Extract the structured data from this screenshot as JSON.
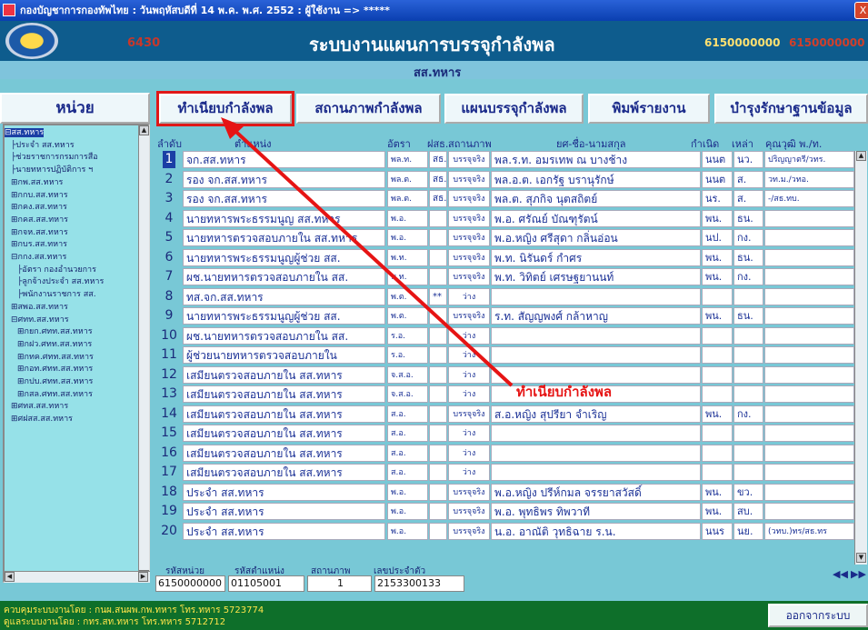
{
  "window": {
    "title": "กองบัญชาการกองทัพไทย : วันพฤหัสบดีที่ 14 พ.ค. พ.ศ. 2552 : ผู้ใช้งาน => *****",
    "close": "X"
  },
  "header": {
    "code": "6430",
    "title": "ระบบงานแผนการบรรจุกำลังพล",
    "num1": "6150000000",
    "num2": "6150000000",
    "subtitle": "สส.ทหาร"
  },
  "tabs": {
    "unit": "หน่วย",
    "t1": "ทำเนียบกำลังพล",
    "t2": "สถานภาพกำลังพล",
    "t3": "แผนบรรจุกำลังพล",
    "t4": "พิมพ์รายงาน",
    "t5": "บำรุงรักษาฐานข้อมูล"
  },
  "tree": [
    {
      "label": "สส.ทหาร",
      "prefix": "⊟",
      "indent": 0,
      "selected": true
    },
    {
      "label": "ประจำ สส.ทหาร",
      "prefix": "├",
      "indent": 1
    },
    {
      "label": "ช่วยราชการกรมการสื่อ",
      "prefix": "├",
      "indent": 1
    },
    {
      "label": "นายทหารปฏิบัติการ ฯ",
      "prefix": "├",
      "indent": 1
    },
    {
      "label": "กพ.สส.ทหาร",
      "prefix": "⊞",
      "indent": 1
    },
    {
      "label": "กกบ.สส.ทหาร",
      "prefix": "⊞",
      "indent": 1
    },
    {
      "label": "กคง.สส.ทหาร",
      "prefix": "⊞",
      "indent": 1
    },
    {
      "label": "กคส.สส.ทหาร",
      "prefix": "⊞",
      "indent": 1
    },
    {
      "label": "กจห.สส.ทหาร",
      "prefix": "⊞",
      "indent": 1
    },
    {
      "label": "กบร.สส.ทหาร",
      "prefix": "⊞",
      "indent": 1
    },
    {
      "label": "กกง.สส.ทหาร",
      "prefix": "⊟",
      "indent": 1
    },
    {
      "label": "อัตรา กองอำนวยการ",
      "prefix": "├",
      "indent": 2
    },
    {
      "label": "ลูกจ้างประจำ สส.ทหาร",
      "prefix": "├",
      "indent": 2
    },
    {
      "label": "พนักงานราชการ สส.",
      "prefix": "├",
      "indent": 2
    },
    {
      "label": "สพอ.สส.ทหาร",
      "prefix": "⊞",
      "indent": 1
    },
    {
      "label": "ศทท.สส.ทหาร",
      "prefix": "⊟",
      "indent": 1
    },
    {
      "label": "กยก.ศทท.สส.ทหาร",
      "prefix": "⊞",
      "indent": 2
    },
    {
      "label": "กฝว.ศทท.สส.ทหาร",
      "prefix": "⊞",
      "indent": 2
    },
    {
      "label": "กทค.ศทท.สส.ทหาร",
      "prefix": "⊞",
      "indent": 2
    },
    {
      "label": "กอท.ศทท.สส.ทหาร",
      "prefix": "⊞",
      "indent": 2
    },
    {
      "label": "กปบ.ศทท.สส.ทหาร",
      "prefix": "⊞",
      "indent": 2
    },
    {
      "label": "กสล.ศทท.สส.ทหาร",
      "prefix": "⊞",
      "indent": 2
    },
    {
      "label": "ศทส.สส.ทหาร",
      "prefix": "⊞",
      "indent": 1
    },
    {
      "label": "ศฝสส.สส.ทหาร",
      "prefix": "⊞",
      "indent": 1
    }
  ],
  "grid": {
    "headers": {
      "no": "ลำดับ",
      "position": "ตำแหน่ง",
      "rate": "อัตรา",
      "flag": "ฝสธ.",
      "status": "สถานภาพ",
      "name": "ยศ-ชื่อ-นามสกุล",
      "born": "กำเนิด",
      "cls": "เหล่า",
      "edu": "คุณวุฒิ พ./ท."
    },
    "rows": [
      {
        "no": "1",
        "position": "จก.สส.ทหาร",
        "rate": "พล.ท.",
        "flag": "สธ.",
        "status": "บรรจุจริง",
        "name": "พล.ร.ท. อมรเทพ ณ บางช้าง",
        "born": "นนต",
        "cls": "นว.",
        "edu": "ปริญญาตรี/วทร."
      },
      {
        "no": "2",
        "position": "รอง จก.สส.ทหาร",
        "rate": "พล.ต.",
        "flag": "สธ.",
        "status": "บรรจุจริง",
        "name": "พล.อ.ต. เอกรัฐ บรานุรักษ์",
        "born": "นนต",
        "cls": "ส.",
        "edu": "วท.ม./วทอ."
      },
      {
        "no": "3",
        "position": "รอง จก.สส.ทหาร",
        "rate": "พล.ต.",
        "flag": "สธ.",
        "status": "บรรจุจริง",
        "name": "พล.ต. สุภกิจ นุตสถิตย์",
        "born": "นร.",
        "cls": "ส.",
        "edu": "-/สธ.ทบ."
      },
      {
        "no": "4",
        "position": "นายทหารพระธรรมนูญ สส.ทหาร",
        "rate": "พ.อ.",
        "flag": "",
        "status": "บรรจุจริง",
        "name": "พ.อ. ศรัณย์ บัณฑุรัตน์",
        "born": "พน.",
        "cls": "ธน.",
        "edu": ""
      },
      {
        "no": "5",
        "position": "นายทหารตรวจสอบภายใน สส.ทหาร",
        "rate": "พ.อ.",
        "flag": "",
        "status": "บรรจุจริง",
        "name": "พ.อ.หญิง ศรีสุดา กลิ่นอ่อน",
        "born": "นป.",
        "cls": "กง.",
        "edu": ""
      },
      {
        "no": "6",
        "position": "นายทหารพระธรรมนูญผู้ช่วย สส.",
        "rate": "พ.ท.",
        "flag": "",
        "status": "บรรจุจริง",
        "name": "พ.ท. นิรันดร์ กำศร",
        "born": "พน.",
        "cls": "ธน.",
        "edu": ""
      },
      {
        "no": "7",
        "position": "ผช.นายทหารตรวจสอบภายใน สส.",
        "rate": "พ.ท.",
        "flag": "",
        "status": "บรรจุจริง",
        "name": "พ.ท. วิทิตย์ เศรษฐยานนท์",
        "born": "พน.",
        "cls": "กง.",
        "edu": ""
      },
      {
        "no": "8",
        "position": "ทส.จก.สส.ทหาร",
        "rate": "พ.ต.",
        "flag": "**",
        "status": "ว่าง",
        "name": "",
        "born": "",
        "cls": "",
        "edu": ""
      },
      {
        "no": "9",
        "position": "นายทหารพระธรรมนูญผู้ช่วย สส.",
        "rate": "พ.ต.",
        "flag": "",
        "status": "บรรจุจริง",
        "name": "ร.ท. สัญญพงศ์ กล้าหาญ",
        "born": "พน.",
        "cls": "ธน.",
        "edu": ""
      },
      {
        "no": "10",
        "position": "ผช.นายทหารตรวจสอบภายใน สส.",
        "rate": "ร.อ.",
        "flag": "",
        "status": "ว่าง",
        "name": "",
        "born": "",
        "cls": "",
        "edu": ""
      },
      {
        "no": "11",
        "position": "ผู้ช่วยนายทหารตรวจสอบภายใน",
        "rate": "ร.อ.",
        "flag": "",
        "status": "ว่าง",
        "name": "",
        "born": "",
        "cls": "",
        "edu": ""
      },
      {
        "no": "12",
        "position": "เสมียนตรวจสอบภายใน สส.ทหาร",
        "rate": "จ.ส.อ.",
        "flag": "",
        "status": "ว่าง",
        "name": "",
        "born": "",
        "cls": "",
        "edu": ""
      },
      {
        "no": "13",
        "position": "เสมียนตรวจสอบภายใน สส.ทหาร",
        "rate": "จ.ส.อ.",
        "flag": "",
        "status": "ว่าง",
        "name": "",
        "born": "",
        "cls": "",
        "edu": ""
      },
      {
        "no": "14",
        "position": "เสมียนตรวจสอบภายใน สส.ทหาร",
        "rate": "ส.อ.",
        "flag": "",
        "status": "บรรจุจริง",
        "name": "ส.อ.หญิง สุปรียา จำเริญ",
        "born": "พน.",
        "cls": "กง.",
        "edu": ""
      },
      {
        "no": "15",
        "position": "เสมียนตรวจสอบภายใน สส.ทหาร",
        "rate": "ส.อ.",
        "flag": "",
        "status": "ว่าง",
        "name": "",
        "born": "",
        "cls": "",
        "edu": ""
      },
      {
        "no": "16",
        "position": "เสมียนตรวจสอบภายใน สส.ทหาร",
        "rate": "ส.อ.",
        "flag": "",
        "status": "ว่าง",
        "name": "",
        "born": "",
        "cls": "",
        "edu": ""
      },
      {
        "no": "17",
        "position": "เสมียนตรวจสอบภายใน สส.ทหาร",
        "rate": "ส.อ.",
        "flag": "",
        "status": "ว่าง",
        "name": "",
        "born": "",
        "cls": "",
        "edu": ""
      },
      {
        "no": "18",
        "position": "ประจำ สส.ทหาร",
        "rate": "พ.อ.",
        "flag": "",
        "status": "บรรจุจริง",
        "name": "พ.อ.หญิง ปรีห์กมล จรรยาสวัสดิ์",
        "born": "พน.",
        "cls": "ขว.",
        "edu": ""
      },
      {
        "no": "19",
        "position": "ประจำ สส.ทหาร",
        "rate": "พ.อ.",
        "flag": "",
        "status": "บรรจุจริง",
        "name": "พ.อ. พุทธิพร ทิพวาที",
        "born": "พน.",
        "cls": "สบ.",
        "edu": ""
      },
      {
        "no": "20",
        "position": "ประจำ สส.ทหาร",
        "rate": "พ.อ.",
        "flag": "",
        "status": "บรรจุจริง",
        "name": "น.อ. อาณัติ วุทธิฉาย ร.น.",
        "born": "นนร",
        "cls": "นย.",
        "edu": "(วทบ.)ทร/สธ.ทร"
      }
    ]
  },
  "record": {
    "unit_code_label": "รหัสหน่วย",
    "pos_code_label": "รหัสตำแหน่ง",
    "status_label": "สถานภาพ",
    "id_label": "เลขประจำตัว",
    "unit_code": "6150000000",
    "pos_code": "01105001",
    "status": "1",
    "id": "2153300133"
  },
  "nav": {
    "prev": "◀◀",
    "next": "▶▶"
  },
  "footer": {
    "line1": "ควบคุมระบบงานโดย : กนผ.สนผพ.กพ.ทหาร  โทร.ทหาร 5723774",
    "line2": "ดูแลระบบงานโดย : กทร.สท.ทหาร       โทร.ทหาร 5712712",
    "exit": "ออกจากระบบ"
  },
  "annotation": {
    "text": "ทำเนียบกำลังพล",
    "color": "#e61414"
  }
}
